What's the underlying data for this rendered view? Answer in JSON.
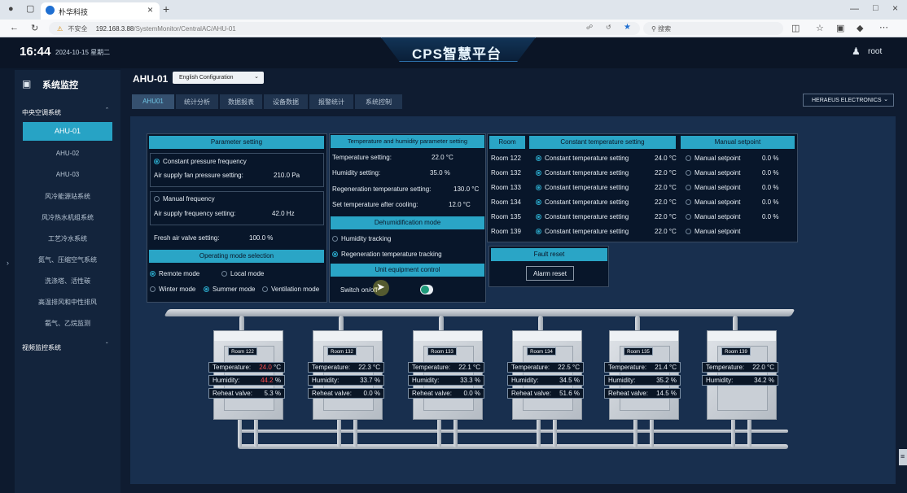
{
  "browser": {
    "tab_title": "朴华科技",
    "url_warning": "不安全",
    "url_host": "192.168.3.88",
    "url_path": "/SystemMonitor/CentralAC/AHU-01",
    "search_placeholder": "搜索",
    "new_tab": "+",
    "close": "×"
  },
  "header": {
    "time": "16:44",
    "date": "2024-10-15 星期二",
    "title": "CPS智慧平台",
    "user": "root"
  },
  "sidebar": {
    "title": "系统监控",
    "section": "中央空调系统",
    "items": [
      "AHU-01",
      "AHU-02",
      "AHU-03",
      "风冷能源站系统",
      "风冷热水机组系统",
      "工艺冷水系统",
      "氮气、压缩空气系统",
      "洗涤塔、活性碳",
      "高温排风和中性排风",
      "氨气、乙烷监测"
    ],
    "section2": "视频监控系统"
  },
  "main": {
    "unit": "AHU-01",
    "language": "English Configuration",
    "tabs": [
      "AHU01",
      "统计分析",
      "数据报表",
      "设备数据",
      "报警统计",
      "系统控制"
    ],
    "company": "HERAEUS ELECTRONICS"
  },
  "param": {
    "title": "Parameter setting",
    "const_pressure": "Constant pressure frequency",
    "fan_pressure_label": "Air supply fan pressure setting:",
    "fan_pressure_value": "210.0 Pa",
    "manual_freq": "Manual frequency",
    "supply_freq_label": "Air supply frequency setting:",
    "supply_freq_value": "42.0 Hz",
    "fresh_air_label": "Fresh air valve setting:",
    "fresh_air_value": "100.0 %",
    "mode_title": "Operating mode selection",
    "remote": "Remote mode",
    "local": "Local mode",
    "winter": "Winter mode",
    "summer": "Summer mode",
    "ventilation": "Ventilation mode"
  },
  "th": {
    "title": "Temperature and humidity parameter setting",
    "temp_label": "Temperature setting:",
    "temp_value": "22.0 °C",
    "hum_label": "Humidity setting:",
    "hum_value": "35.0 %",
    "regen_label": "Regeneration temperature setting:",
    "regen_value": "130.0 °C",
    "cool_label": "Set temperature after cooling:",
    "cool_value": "12.0 °C",
    "dehum_title": "Dehumidification mode",
    "hum_tracking": "Humidity tracking",
    "regen_tracking": "Regeneration temperature tracking",
    "unit_title": "Unit equipment control",
    "switch": "Switch on/off"
  },
  "rooms_table": {
    "h_room": "Room",
    "h_const": "Constant temperature setting",
    "h_manual": "Manual setpoint",
    "const_label": "Constant temperature setting",
    "manual_label": "Manual setpoint",
    "rows": [
      {
        "room": "Room 122",
        "const": "24.0 °C",
        "manual": "0.0 %"
      },
      {
        "room": "Room 132",
        "const": "22.0 °C",
        "manual": "0.0 %"
      },
      {
        "room": "Room 133",
        "const": "22.0 °C",
        "manual": "0.0 %"
      },
      {
        "room": "Room 134",
        "const": "22.0 °C",
        "manual": "0.0 %"
      },
      {
        "room": "Room 135",
        "const": "22.0 °C",
        "manual": "0.0 %"
      },
      {
        "room": "Room 139",
        "const": "22.0 °C",
        "manual": ""
      }
    ]
  },
  "fault": {
    "title": "Fault reset",
    "button": "Alarm reset"
  },
  "cabinets": [
    {
      "room": "Room 122",
      "temp_label": "Temperature:",
      "temp": "24.0",
      "temp_unit": "°C",
      "hum_label": "Humidity:",
      "hum": "44.2",
      "hum_unit": "%",
      "valve_label": "Reheat valve:",
      "valve": "5.3 %",
      "temp_alarm": true,
      "hum_alarm": true
    },
    {
      "room": "Room 132",
      "temp_label": "Temperature:",
      "temp": "22.3",
      "temp_unit": "°C",
      "hum_label": "Humidity:",
      "hum": "33.7",
      "hum_unit": "%",
      "valve_label": "Reheat valve:",
      "valve": "0.0 %"
    },
    {
      "room": "Room 133",
      "temp_label": "Temperature:",
      "temp": "22.1",
      "temp_unit": "°C",
      "hum_label": "Humidity:",
      "hum": "33.3",
      "hum_unit": "%",
      "valve_label": "Reheat valve:",
      "valve": "0.0 %"
    },
    {
      "room": "Room 134",
      "temp_label": "Temperature:",
      "temp": "22.5",
      "temp_unit": "°C",
      "hum_label": "Humidity:",
      "hum": "34.5",
      "hum_unit": "%",
      "valve_label": "Reheat valve:",
      "valve": "51.6 %"
    },
    {
      "room": "Room 135",
      "temp_label": "Temperature:",
      "temp": "21.4",
      "temp_unit": "°C",
      "hum_label": "Humidity:",
      "hum": "35.2",
      "hum_unit": "%",
      "valve_label": "Reheat valve:",
      "valve": "14.5 %"
    },
    {
      "room": "Room 139",
      "temp_label": "Temperature:",
      "temp": "22.0",
      "temp_unit": "°C",
      "hum_label": "Humidity:",
      "hum": "34.2",
      "hum_unit": "%"
    }
  ],
  "colors": {
    "accent": "#2aa5c6",
    "alarm": "#ff4d4d",
    "panel": "#08162a"
  }
}
